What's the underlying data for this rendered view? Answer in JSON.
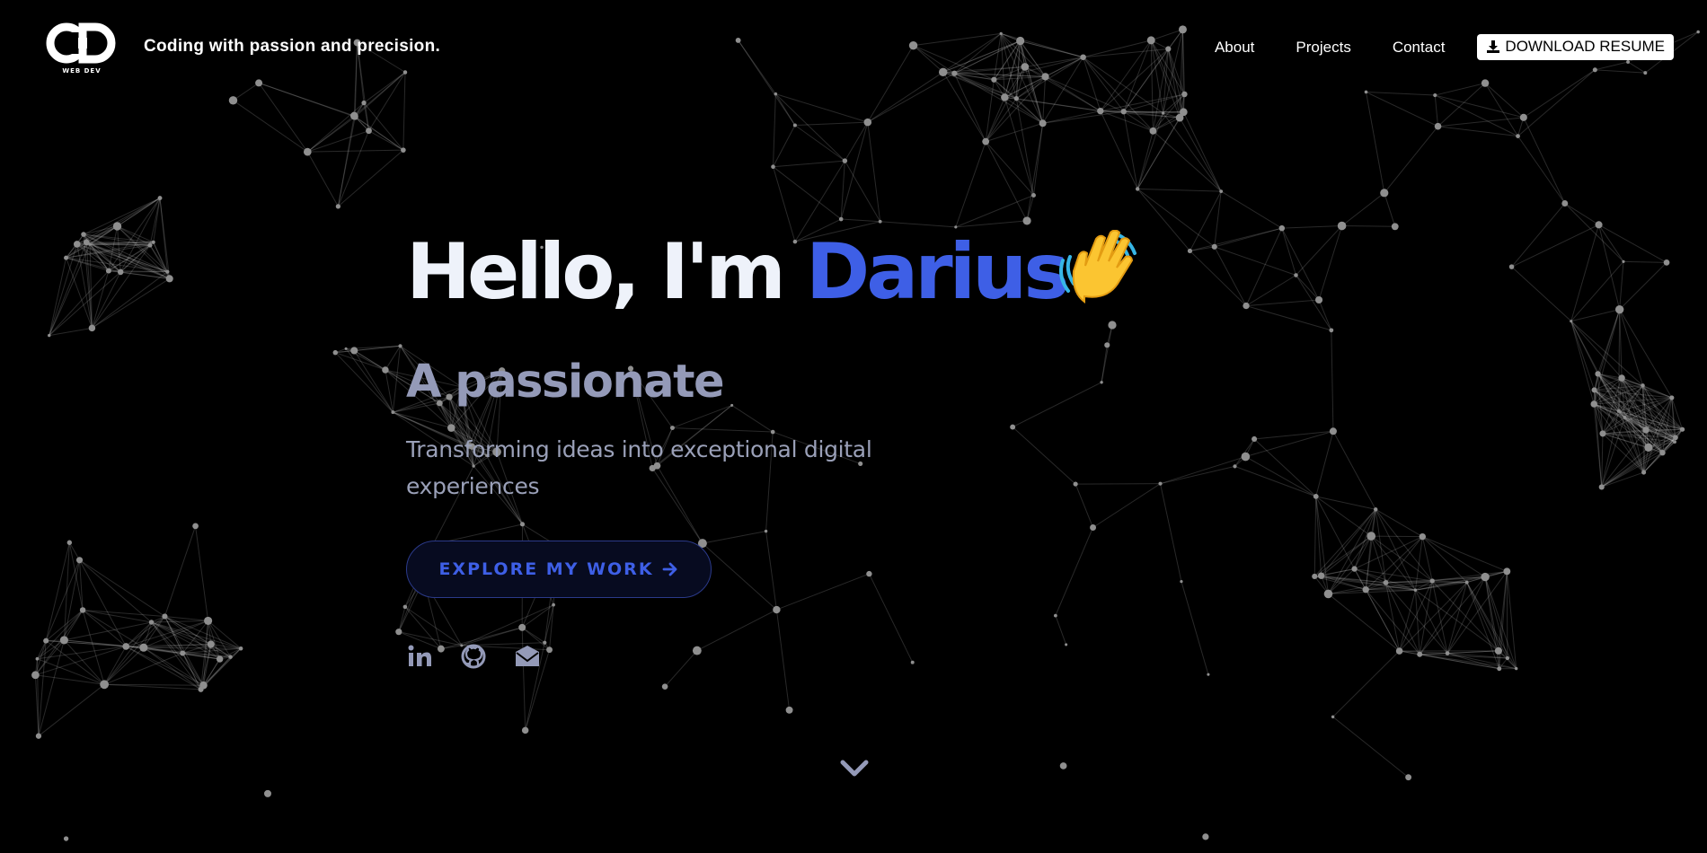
{
  "header": {
    "logo_icon": "cd-web-dev-logo",
    "tagline": "Coding with passion and precision.",
    "nav": [
      {
        "label": "About"
      },
      {
        "label": "Projects"
      },
      {
        "label": "Contact"
      }
    ],
    "resume_button": {
      "label": "DOWNLOAD RESUME",
      "icon": "download-icon"
    }
  },
  "hero": {
    "greeting": "Hello, I'm",
    "name": "Darius",
    "emoji": "waving-hand-icon",
    "subtitle": "A passionate",
    "description": "Transforming ideas into exceptional digital experiences",
    "cta": {
      "label": "EXPLORE MY WORK",
      "icon": "arrow-right-icon"
    },
    "socials": [
      {
        "icon": "linkedin-icon"
      },
      {
        "icon": "github-icon"
      },
      {
        "icon": "envelope-icon"
      }
    ],
    "scroll_icon": "chevron-down-icon"
  },
  "colors": {
    "background": "#000000",
    "accent": "#3e5fe6",
    "heading": "#eef2fa",
    "muted": "#949ab8",
    "network_node": "#8f8f8f"
  }
}
